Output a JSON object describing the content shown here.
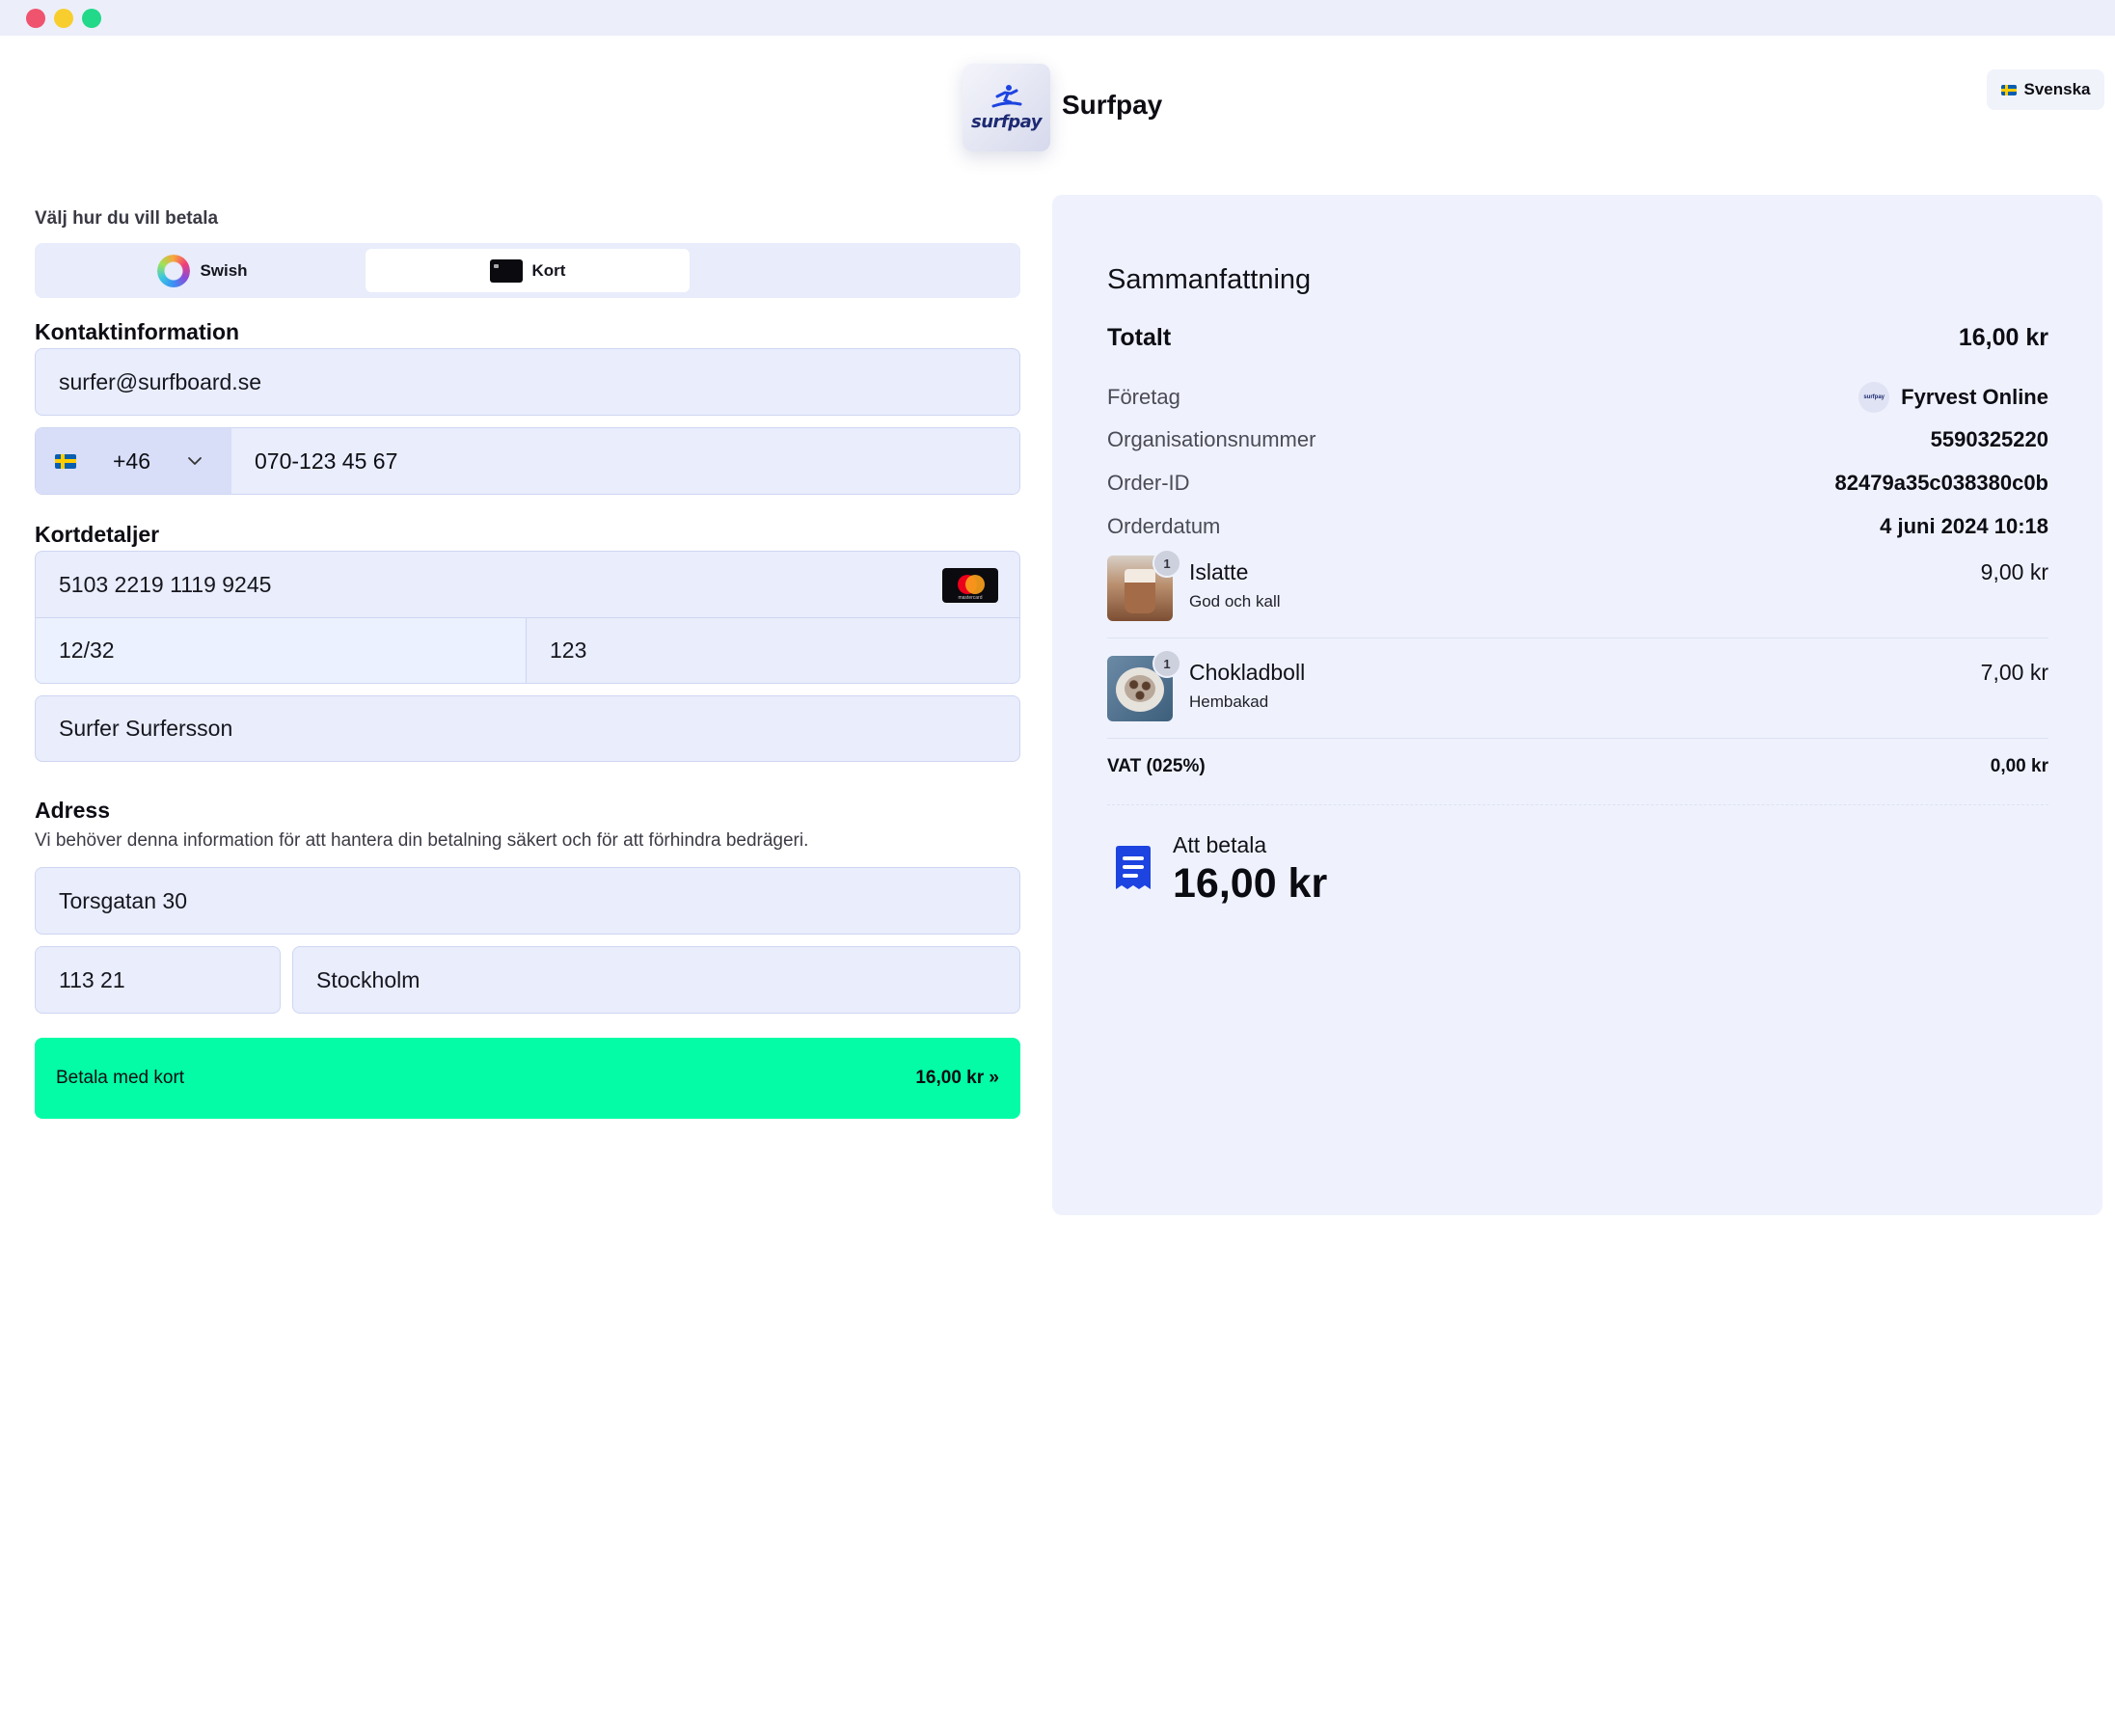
{
  "header": {
    "logo_word": "surfpay",
    "brand_name": "Surfpay",
    "language": "Svenska"
  },
  "payment_method": {
    "label": "Välj hur du vill betala",
    "tabs": [
      {
        "label": "Swish",
        "selected": false
      },
      {
        "label": "Kort",
        "selected": true
      }
    ]
  },
  "contact": {
    "title": "Kontaktinformation",
    "email": "surfer@surfboard.se",
    "phone_code": "+46",
    "phone_number": "070-123 45 67"
  },
  "card": {
    "title": "Kortdetaljer",
    "number": "5103 2219 1119 9245",
    "brand_text": "mastercard",
    "expiry": "12/32",
    "cvc": "123",
    "holder": "Surfer Surfersson"
  },
  "address": {
    "title": "Adress",
    "description": "Vi behöver denna information för att hantera din betalning säkert och för att förhindra bedrägeri.",
    "street": "Torsgatan 30",
    "zip": "113 21",
    "city": "Stockholm"
  },
  "pay_button": {
    "label": "Betala med kort",
    "amount": "16,00 kr »"
  },
  "summary": {
    "title": "Sammanfattning",
    "total_label": "Totalt",
    "total_value": "16,00 kr",
    "rows": [
      {
        "label": "Företag",
        "value": "Fyrvest Online"
      },
      {
        "label": "Organisationsnummer",
        "value": "5590325220"
      },
      {
        "label": "Order-ID",
        "value": "82479a35c038380c0b"
      },
      {
        "label": "Orderdatum",
        "value": "4 juni 2024 10:18"
      }
    ],
    "company_logo_text": "surfpay",
    "items": [
      {
        "qty": "1",
        "name": "Islatte",
        "sub": "God och kall",
        "price": "9,00 kr"
      },
      {
        "qty": "1",
        "name": "Chokladboll",
        "sub": "Hembakad",
        "price": "7,00 kr"
      }
    ],
    "vat_label": "VAT (025%)",
    "vat_value": "0,00 kr",
    "to_pay_label": "Att betala",
    "to_pay_amount": "16,00 kr"
  },
  "colors": {
    "accent_green": "#03fca5",
    "field_bg": "#e9edfc",
    "panel_bg": "#eff2fd",
    "icon_blue": "#1d44e0"
  },
  "icons": [
    "swish-icon",
    "card-icon",
    "flag-se-icon",
    "chevron-down-icon",
    "mastercard-icon",
    "receipt-icon",
    "surfer-logo-icon"
  ]
}
